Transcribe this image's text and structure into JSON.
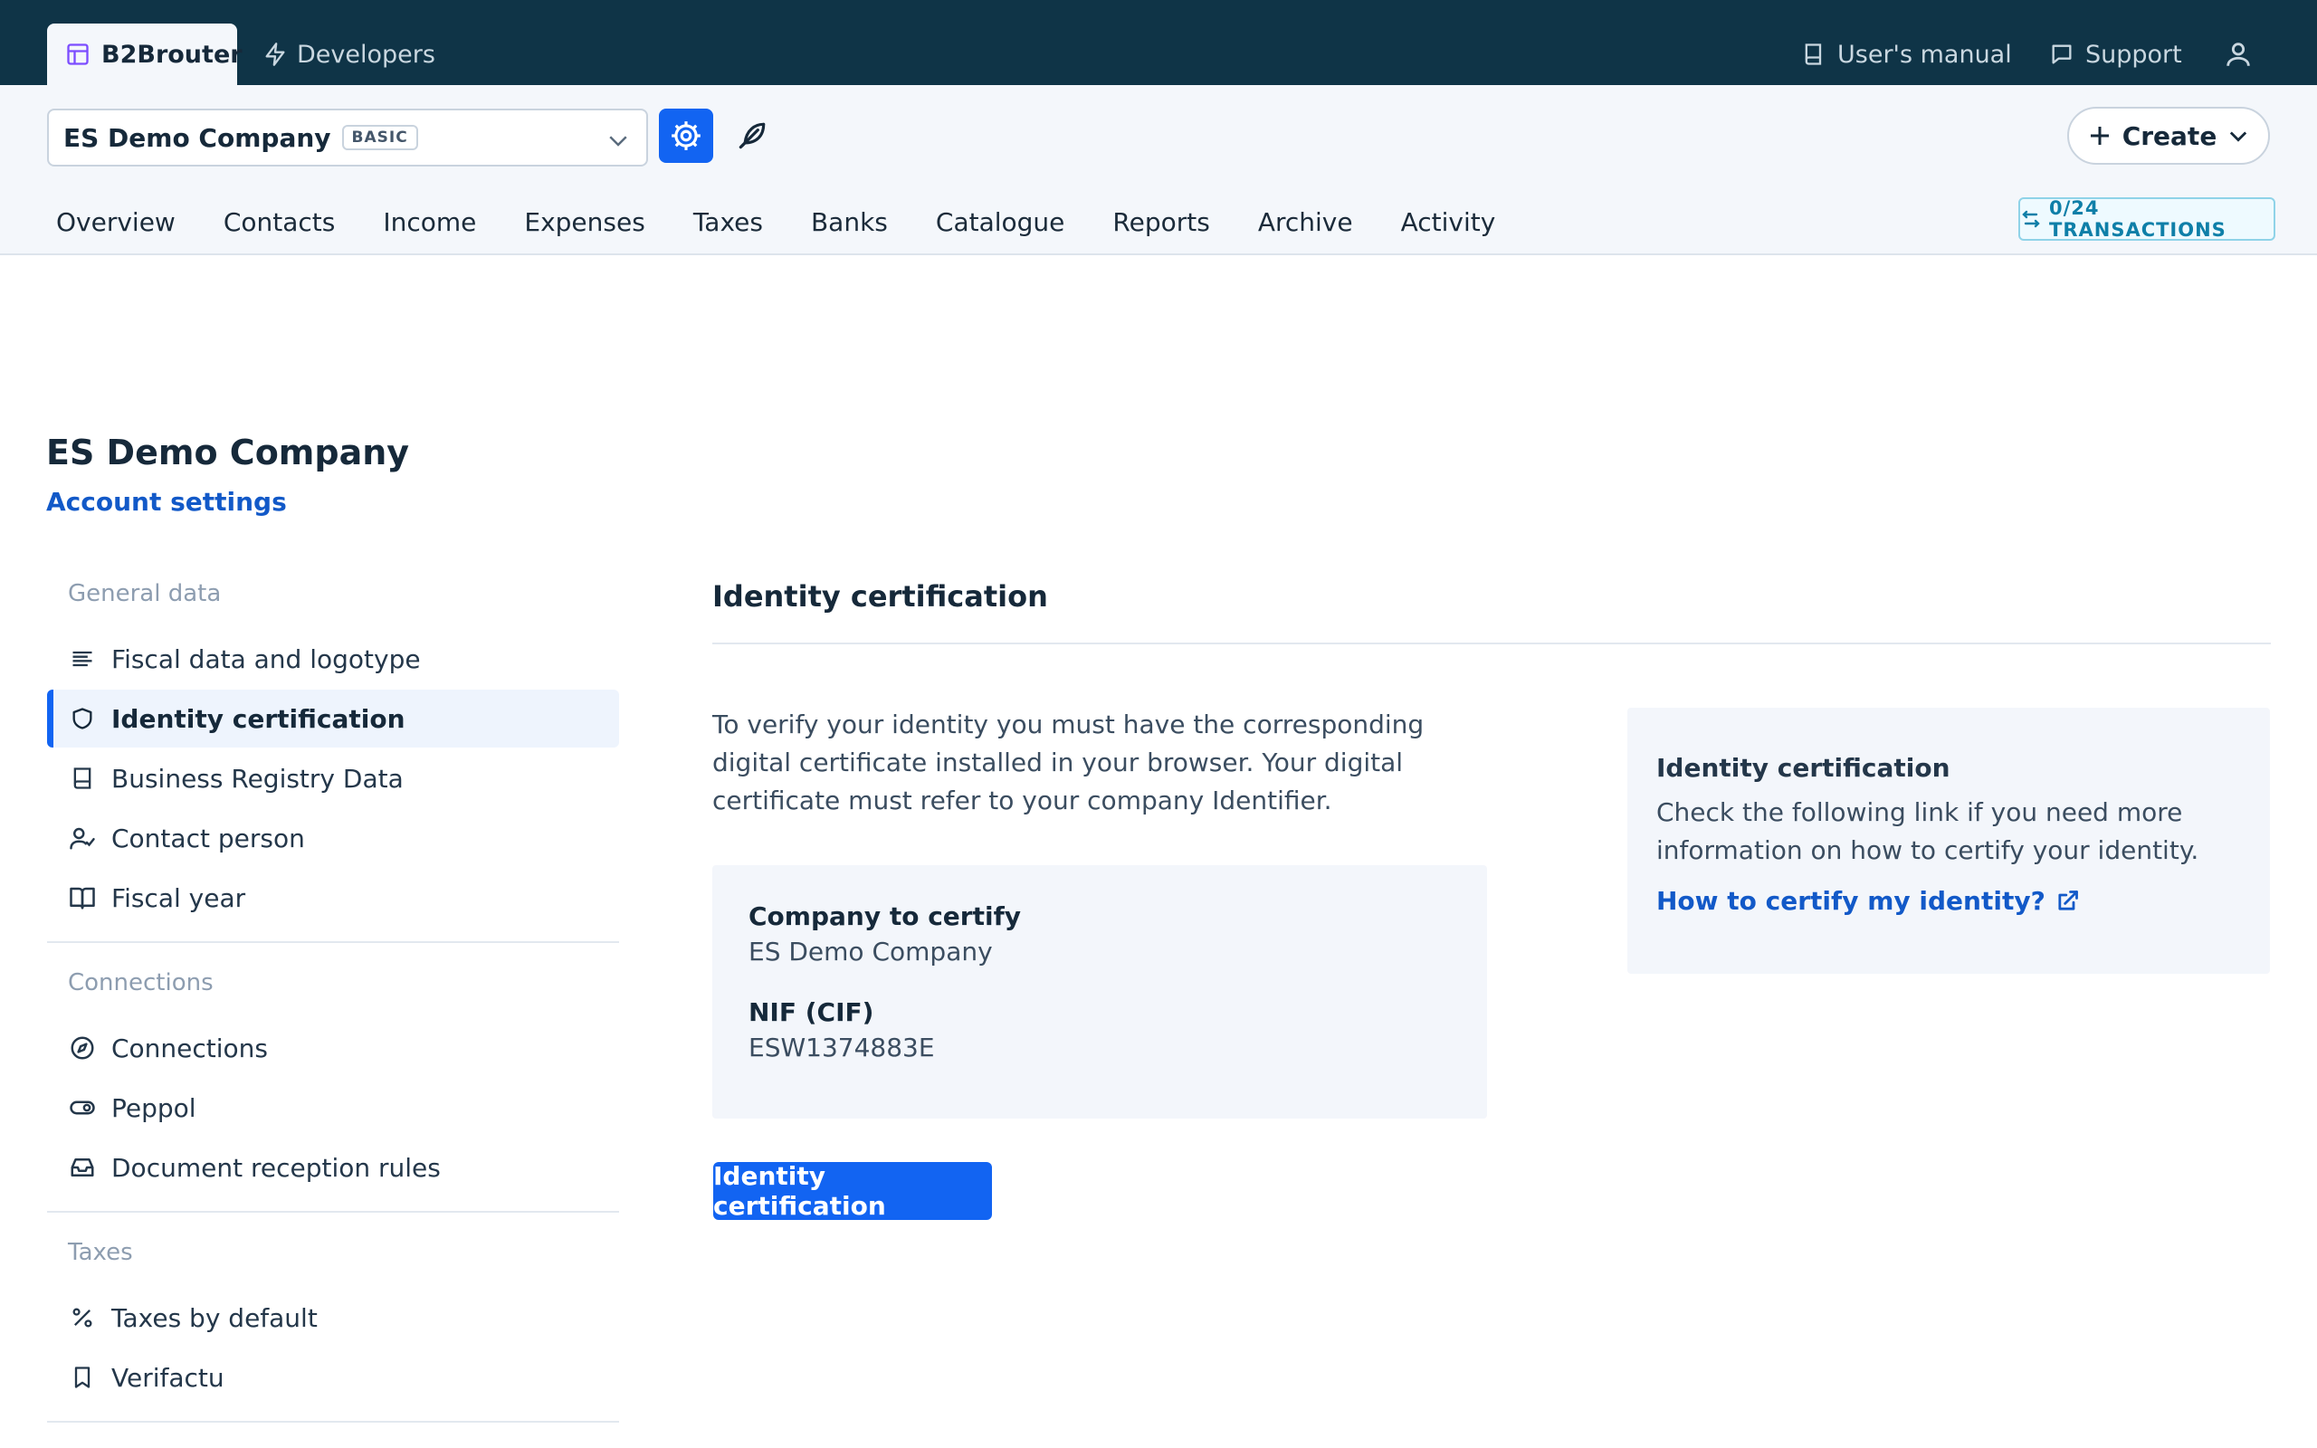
{
  "topbar": {
    "brand_tab": "B2Brouter",
    "developers_tab": "Developers",
    "users_manual": "User's manual",
    "support": "Support"
  },
  "header": {
    "company_name": "ES Demo Company",
    "plan_badge": "BASIC",
    "create_label": "Create",
    "transactions_badge": "0/24 TRANSACTIONS",
    "nav": [
      "Overview",
      "Contacts",
      "Income",
      "Expenses",
      "Taxes",
      "Banks",
      "Catalogue",
      "Reports",
      "Archive",
      "Activity"
    ]
  },
  "page": {
    "title": "ES Demo Company",
    "subtitle": "Account settings"
  },
  "sidebar": {
    "general_title": "General data",
    "general_items": [
      {
        "label": "Fiscal data and logotype",
        "icon": "align-left-icon"
      },
      {
        "label": "Identity certification",
        "icon": "shield-icon",
        "active": true
      },
      {
        "label": "Business Registry Data",
        "icon": "book-icon"
      },
      {
        "label": "Contact person",
        "icon": "user-check-icon"
      },
      {
        "label": "Fiscal year",
        "icon": "open-book-icon"
      }
    ],
    "connections_title": "Connections",
    "connections_items": [
      {
        "label": "Connections",
        "icon": "compass-icon"
      },
      {
        "label": "Peppol",
        "icon": "toggle-icon"
      },
      {
        "label": "Document reception rules",
        "icon": "inbox-icon"
      }
    ],
    "taxes_title": "Taxes",
    "taxes_items": [
      {
        "label": "Taxes by default",
        "icon": "percent-icon"
      },
      {
        "label": "Verifactu",
        "icon": "bookmark-icon"
      }
    ]
  },
  "main": {
    "title": "Identity certification",
    "description": "To verify your identity you must have the corresponding digital certificate installed in your browser. Your digital certificate must refer to your company Identifier.",
    "company_label": "Company to certify",
    "company_value": "ES Demo Company",
    "nif_label": "NIF (CIF)",
    "nif_value": "ESW1374883E",
    "button_label": "Identity certification"
  },
  "info": {
    "title": "Identity certification",
    "text": "Check the following link if you need more information on how to certify your identity.",
    "link_label": "How to certify my identity?"
  },
  "colors": {
    "topbar": "#0f3447",
    "accent": "#1264f2",
    "link": "#1259c8"
  }
}
